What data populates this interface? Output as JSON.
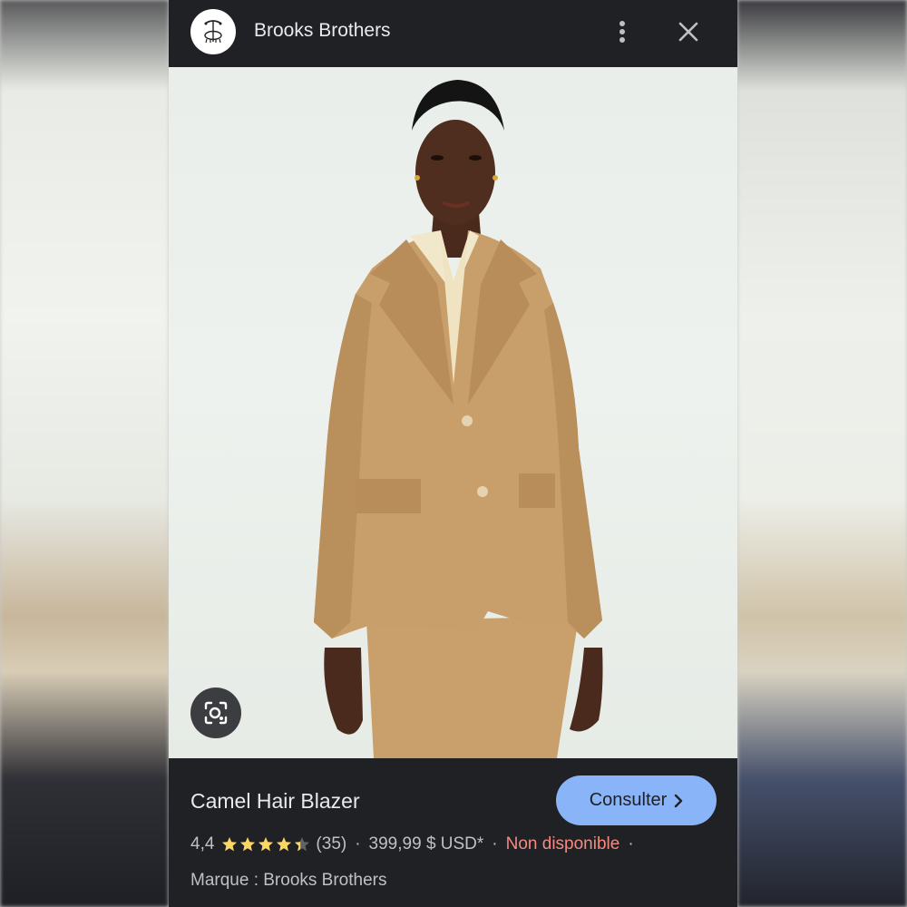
{
  "header": {
    "site_name": "Brooks Brothers",
    "logo_icon": "golden-fleece-logo-icon",
    "more_icon": "more-vert-icon",
    "close_icon": "close-icon"
  },
  "image": {
    "lens_icon": "lens-search-icon"
  },
  "product": {
    "title": "Camel Hair Blazer",
    "visit_label": "Consulter",
    "rating_value": "4,4",
    "rating": 4.4,
    "rating_max": 5,
    "review_count": "(35)",
    "price": "399,99 $ USD*",
    "availability": "Non disponible",
    "brand_line": "Marque : Brooks Brothers"
  },
  "colors": {
    "accent": "#8ab4f8",
    "star": "#fdd663",
    "unavailable": "#f28b82",
    "background": "#202124"
  }
}
